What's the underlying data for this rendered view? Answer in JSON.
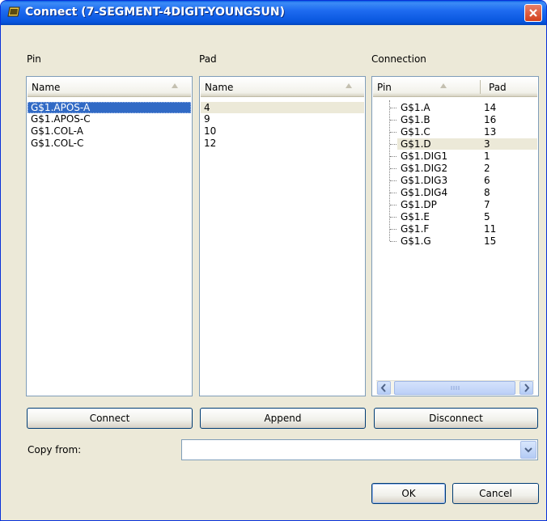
{
  "window": {
    "title": "Connect  (7-SEGMENT-4DIGIT-YOUNGSUN)"
  },
  "pin_panel": {
    "label": "Pin",
    "column": "Name",
    "items": [
      "G$1.APOS-A",
      "G$1.APOS-C",
      "G$1.COL-A",
      "G$1.COL-C"
    ]
  },
  "pad_panel": {
    "label": "Pad",
    "column": "Name",
    "items": [
      "4",
      "9",
      "10",
      "12"
    ]
  },
  "connection_panel": {
    "label": "Connection",
    "columns": [
      "Pin",
      "Pad"
    ],
    "rows": [
      {
        "pin": "G$1.A",
        "pad": "14"
      },
      {
        "pin": "G$1.B",
        "pad": "16"
      },
      {
        "pin": "G$1.C",
        "pad": "13"
      },
      {
        "pin": "G$1.D",
        "pad": "3"
      },
      {
        "pin": "G$1.DIG1",
        "pad": "1"
      },
      {
        "pin": "G$1.DIG2",
        "pad": "2"
      },
      {
        "pin": "G$1.DIG3",
        "pad": "6"
      },
      {
        "pin": "G$1.DIG4",
        "pad": "8"
      },
      {
        "pin": "G$1.DP",
        "pad": "7"
      },
      {
        "pin": "G$1.E",
        "pad": "5"
      },
      {
        "pin": "G$1.F",
        "pad": "11"
      },
      {
        "pin": "G$1.G",
        "pad": "15"
      }
    ]
  },
  "buttons": {
    "connect": "Connect",
    "append": "Append",
    "disconnect": "Disconnect",
    "ok": "OK",
    "cancel": "Cancel"
  },
  "copy_from": {
    "label": "Copy from:",
    "value": ""
  }
}
